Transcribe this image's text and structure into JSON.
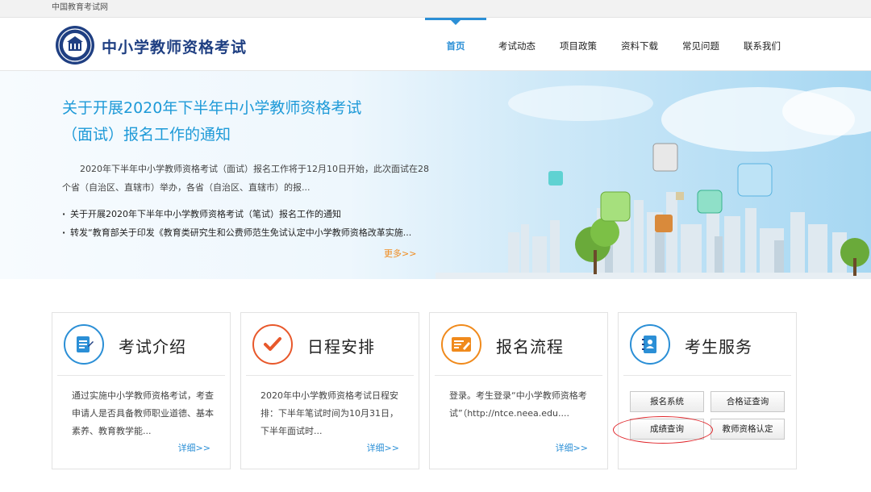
{
  "topbar": {
    "site_name": "中国教育考试网"
  },
  "header": {
    "title": "中小学教师资格考试",
    "nav": [
      {
        "label": "首页",
        "active": true
      },
      {
        "label": "考试动态"
      },
      {
        "label": "项目政策"
      },
      {
        "label": "资料下载"
      },
      {
        "label": "常见问题"
      },
      {
        "label": "联系我们"
      }
    ]
  },
  "banner": {
    "headline_line1": "关于开展2020年下半年中小学教师资格考试",
    "headline_line2": "（面试）报名工作的通知",
    "description": "2020年下半年中小学教师资格考试（面试）报名工作将于12月10日开始，此次面试在28个省（自治区、直辖市）举办，各省（自治区、直辖市）的报...",
    "list": [
      "关于开展2020年下半年中小学教师资格考试（笔试）报名工作的通知",
      "转发“教育部关于印发《教育类研究生和公费师范生免试认定中小学教师资格改革实施..."
    ],
    "more": "更多>>"
  },
  "cards": [
    {
      "title": "考试介绍",
      "icon": "document-icon",
      "accent": "#2b8fd6",
      "text": "通过实施中小学教师资格考试，考查申请人是否具备教师职业道德、基本素养、教育教学能...",
      "more": "详细>>"
    },
    {
      "title": "日程安排",
      "icon": "checkmark-icon",
      "accent": "#e8582b",
      "text": "2020年中小学教师资格考试日程安排：下半年笔试时间为10月31日，下半年面试时...",
      "more": "详细>>"
    },
    {
      "title": "报名流程",
      "icon": "form-icon",
      "accent": "#f08a1c",
      "text": "登录。考生登录“中小学教师资格考试”（http://ntce.neea.edu....",
      "more": "详细>>"
    },
    {
      "title": "考生服务",
      "icon": "contacts-icon",
      "accent": "#2b8fd6"
    }
  ],
  "services": {
    "register": "报名系统",
    "certificate": "合格证查询",
    "score": "成绩查询",
    "qualification": "教师资格认定"
  },
  "colors": {
    "primary": "#2b8fd6",
    "brand": "#1f3f82",
    "highlight": "#e0262b"
  }
}
